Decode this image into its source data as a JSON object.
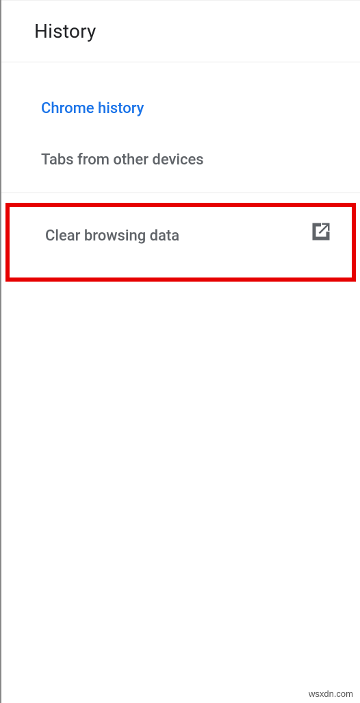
{
  "header": {
    "title": "History"
  },
  "menu": {
    "chrome_history": "Chrome history",
    "other_devices": "Tabs from other devices",
    "clear_data": "Clear browsing data"
  },
  "colors": {
    "active_link": "#1a73e8",
    "text_muted": "#5f6368",
    "highlight_border": "#e60000"
  },
  "watermark": "wsxdn.com"
}
